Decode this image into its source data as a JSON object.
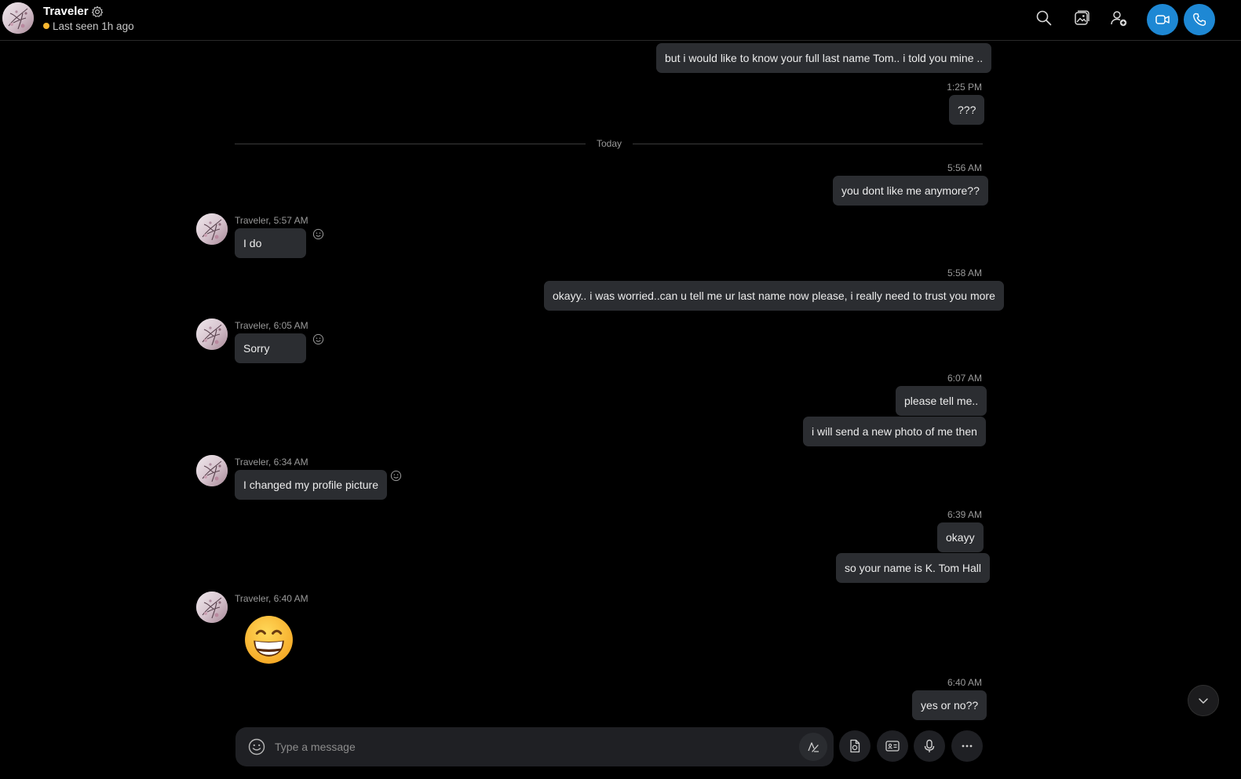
{
  "header": {
    "contact_name": "Traveler",
    "status_text": "Last seen 1h ago"
  },
  "divider": {
    "label": "Today"
  },
  "messages": [
    {
      "side": "out",
      "text": "but i would like to know your full last name Tom.. i told you mine .."
    },
    {
      "side": "out",
      "time": "1:25 PM",
      "text": "???"
    },
    {
      "side": "out",
      "time": "5:56 AM",
      "text": "you dont like me anymore??"
    },
    {
      "side": "in",
      "meta": "Traveler, 5:57 AM",
      "text": "I do"
    },
    {
      "side": "out",
      "time": "5:58 AM",
      "text": "okayy.. i was worried..can u tell me ur last name now please, i really need to trust you more"
    },
    {
      "side": "in",
      "meta": "Traveler, 6:05 AM",
      "text": "Sorry"
    },
    {
      "side": "out",
      "time": "6:07 AM",
      "text": "please tell me.."
    },
    {
      "side": "out",
      "text": "i will send a new photo of me then"
    },
    {
      "side": "in",
      "meta": "Traveler, 6:34 AM",
      "text": "I changed my profile picture"
    },
    {
      "side": "out",
      "time": "6:39 AM",
      "text": "okayy"
    },
    {
      "side": "out",
      "text": "so your name is K. Tom Hall"
    },
    {
      "side": "in",
      "meta": "Traveler, 6:40 AM",
      "emoji": "beaming-face-with-smiling-eyes"
    },
    {
      "side": "out",
      "time": "6:40 AM",
      "text": "yes or no??"
    }
  ],
  "composer": {
    "placeholder": "Type a message"
  },
  "colors": {
    "accent": "#1e88d4",
    "bubble": "#2b2d31",
    "status_away": "#f8b630",
    "background": "#000000"
  },
  "icons": {
    "header": [
      "settings-gear-icon",
      "search-icon",
      "gallery-icon",
      "add-people-icon",
      "video-call-icon",
      "audio-call-icon"
    ],
    "composer": [
      "emoji-icon",
      "format-text-icon",
      "add-file-icon",
      "contact-card-icon",
      "microphone-icon",
      "more-icon"
    ],
    "scroll": "chevron-down-icon"
  }
}
